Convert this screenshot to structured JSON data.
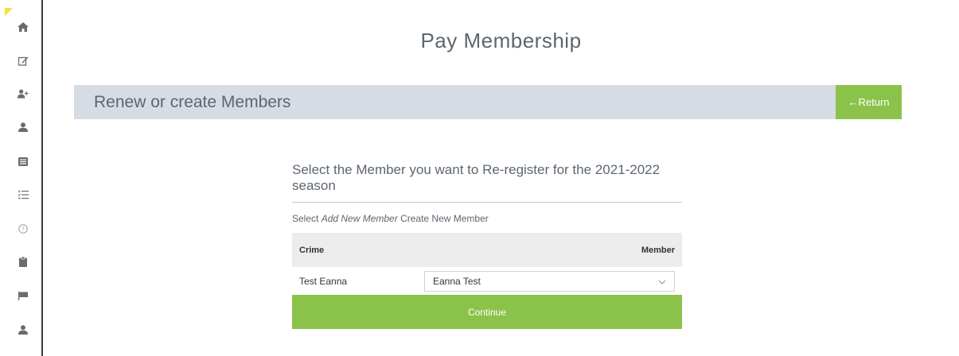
{
  "page": {
    "title": "Pay Membership"
  },
  "banner": {
    "text": "Renew or create Members",
    "return_label": "←Return"
  },
  "content": {
    "heading": "Select the Member you want to Re-register for the 2021-2022 season",
    "hint_prefix": "Select ",
    "hint_emphasis": "Add New Member",
    "hint_suffix": " Create New Member"
  },
  "table": {
    "headers": [
      "Crime",
      "Member"
    ],
    "rows": [
      {
        "name": "Test Eanna",
        "selected_member": "Eanna Test"
      }
    ]
  },
  "continue_label": "Continue",
  "colors": {
    "accent": "#8bc34a",
    "banner_bg": "#d6dce3",
    "header_bg": "#ececec"
  },
  "sidebar": {
    "icons": [
      "home-icon",
      "edit-icon",
      "add-user-icon",
      "user-icon",
      "list-icon",
      "checklist-icon",
      "help-icon",
      "clipboard-icon",
      "flag-icon",
      "profile-icon"
    ]
  }
}
